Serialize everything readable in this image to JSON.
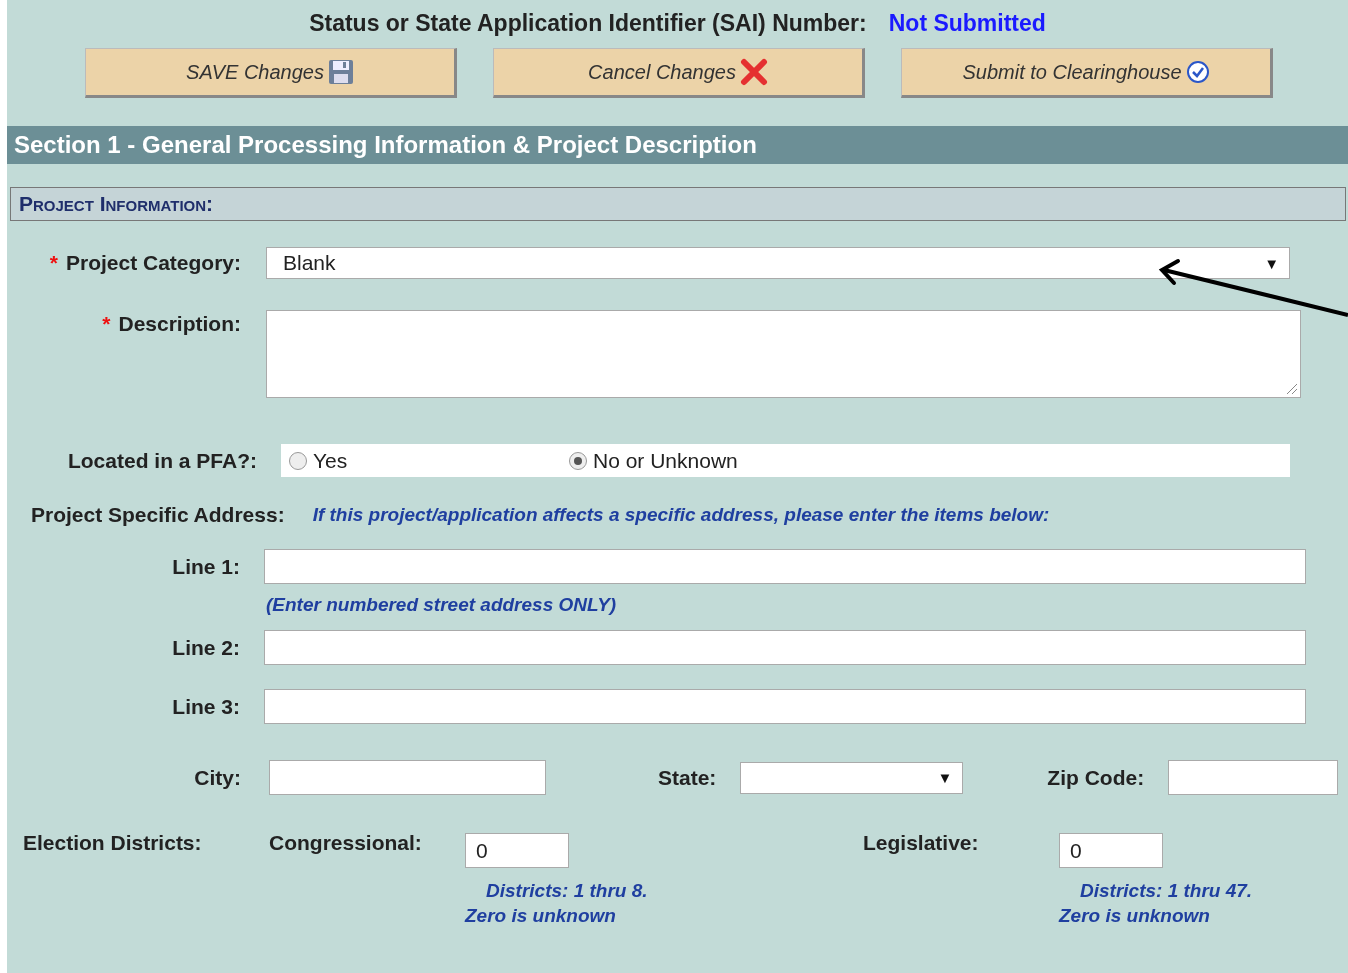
{
  "header": {
    "label": "Status or State Application Identifier (SAI) Number:",
    "status": "Not Submitted"
  },
  "buttons": [
    {
      "label": "SAVE Changes"
    },
    {
      "label": "Cancel Changes"
    },
    {
      "label": "Submit to Clearinghouse"
    }
  ],
  "section": {
    "title": "Section 1 - General Processing Information & Project Description"
  },
  "subsection": {
    "title": "Project Information:"
  },
  "category": {
    "label": "Project Category:",
    "required_mark": "*",
    "value": "Blank",
    "caret": "▼"
  },
  "description": {
    "label": "Description:",
    "required_mark": "*"
  },
  "pfa": {
    "label": "Located in a PFA?:",
    "options": [
      {
        "label": "Yes",
        "selected": false
      },
      {
        "label": "No or Unknown",
        "selected": true
      }
    ]
  },
  "address": {
    "label": "Project Specific Address:",
    "note": "If this project/application affects a specific address, please enter the items below:",
    "lines": [
      {
        "label": "Line 1:",
        "hint": "(Enter numbered street address ONLY)"
      },
      {
        "label": "Line 2:"
      },
      {
        "label": "Line 3:"
      }
    ],
    "city": {
      "label": "City:"
    },
    "state": {
      "label": "State:",
      "caret": "▼"
    },
    "zip": {
      "label": "Zip Code:"
    }
  },
  "election": {
    "label": "Election Districts:",
    "districts": [
      {
        "label": "Congressional:",
        "value": "0",
        "note": [
          "Districts: 1 thru 8.",
          "Zero is unknown"
        ]
      },
      {
        "label": "Legislative:",
        "value": "0",
        "note": [
          "Districts: 1 thru 47.",
          "Zero is unknown"
        ]
      }
    ]
  }
}
